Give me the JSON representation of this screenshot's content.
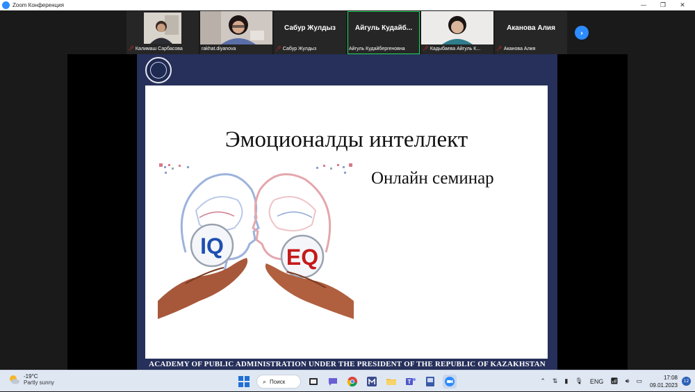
{
  "window": {
    "title": "Zoom Конференция",
    "minimize_glyph": "—",
    "restore_glyph": "❐",
    "close_glyph": "✕"
  },
  "participants": [
    {
      "name": "Калимаш Сарбасова",
      "muted": true,
      "video": true,
      "display_name": ""
    },
    {
      "name": "rakhat.diyanova",
      "muted": false,
      "video": true,
      "display_name": ""
    },
    {
      "name": "Сабур Жулдыз",
      "muted": true,
      "video": false,
      "display_name": "Сабур Жулдыз"
    },
    {
      "name": "Айгуль Кудайбергеновна",
      "muted": false,
      "video": false,
      "display_name": "Айгуль Кудайб...",
      "active_speaker": true
    },
    {
      "name": "Кадыбаева Айгуль К...",
      "muted": true,
      "video": true,
      "display_name": ""
    },
    {
      "name": "Аканова Алия",
      "muted": true,
      "video": false,
      "display_name": "Аканова Алия"
    }
  ],
  "next_page_glyph": "›",
  "slide": {
    "heading": "Эмоционалды интеллект",
    "subheading": "Онлайн семинар",
    "left_label": "IQ",
    "right_label": "EQ",
    "footer": "ACADEMY OF PUBLIC ADMINISTRATION UNDER THE PRESIDENT OF THE REPUBLIC OF KAZAKHSTAN",
    "colors": {
      "navy": "#26305a",
      "iq_blue": "#1e4fb0",
      "eq_red": "#c41a1a"
    }
  },
  "taskbar": {
    "weather_temp": "-19°C",
    "weather_desc": "Partly sunny",
    "search_label": "Поиск",
    "language": "ENG",
    "time": "17:08",
    "date": "09.01.2023",
    "notifications": "12"
  }
}
